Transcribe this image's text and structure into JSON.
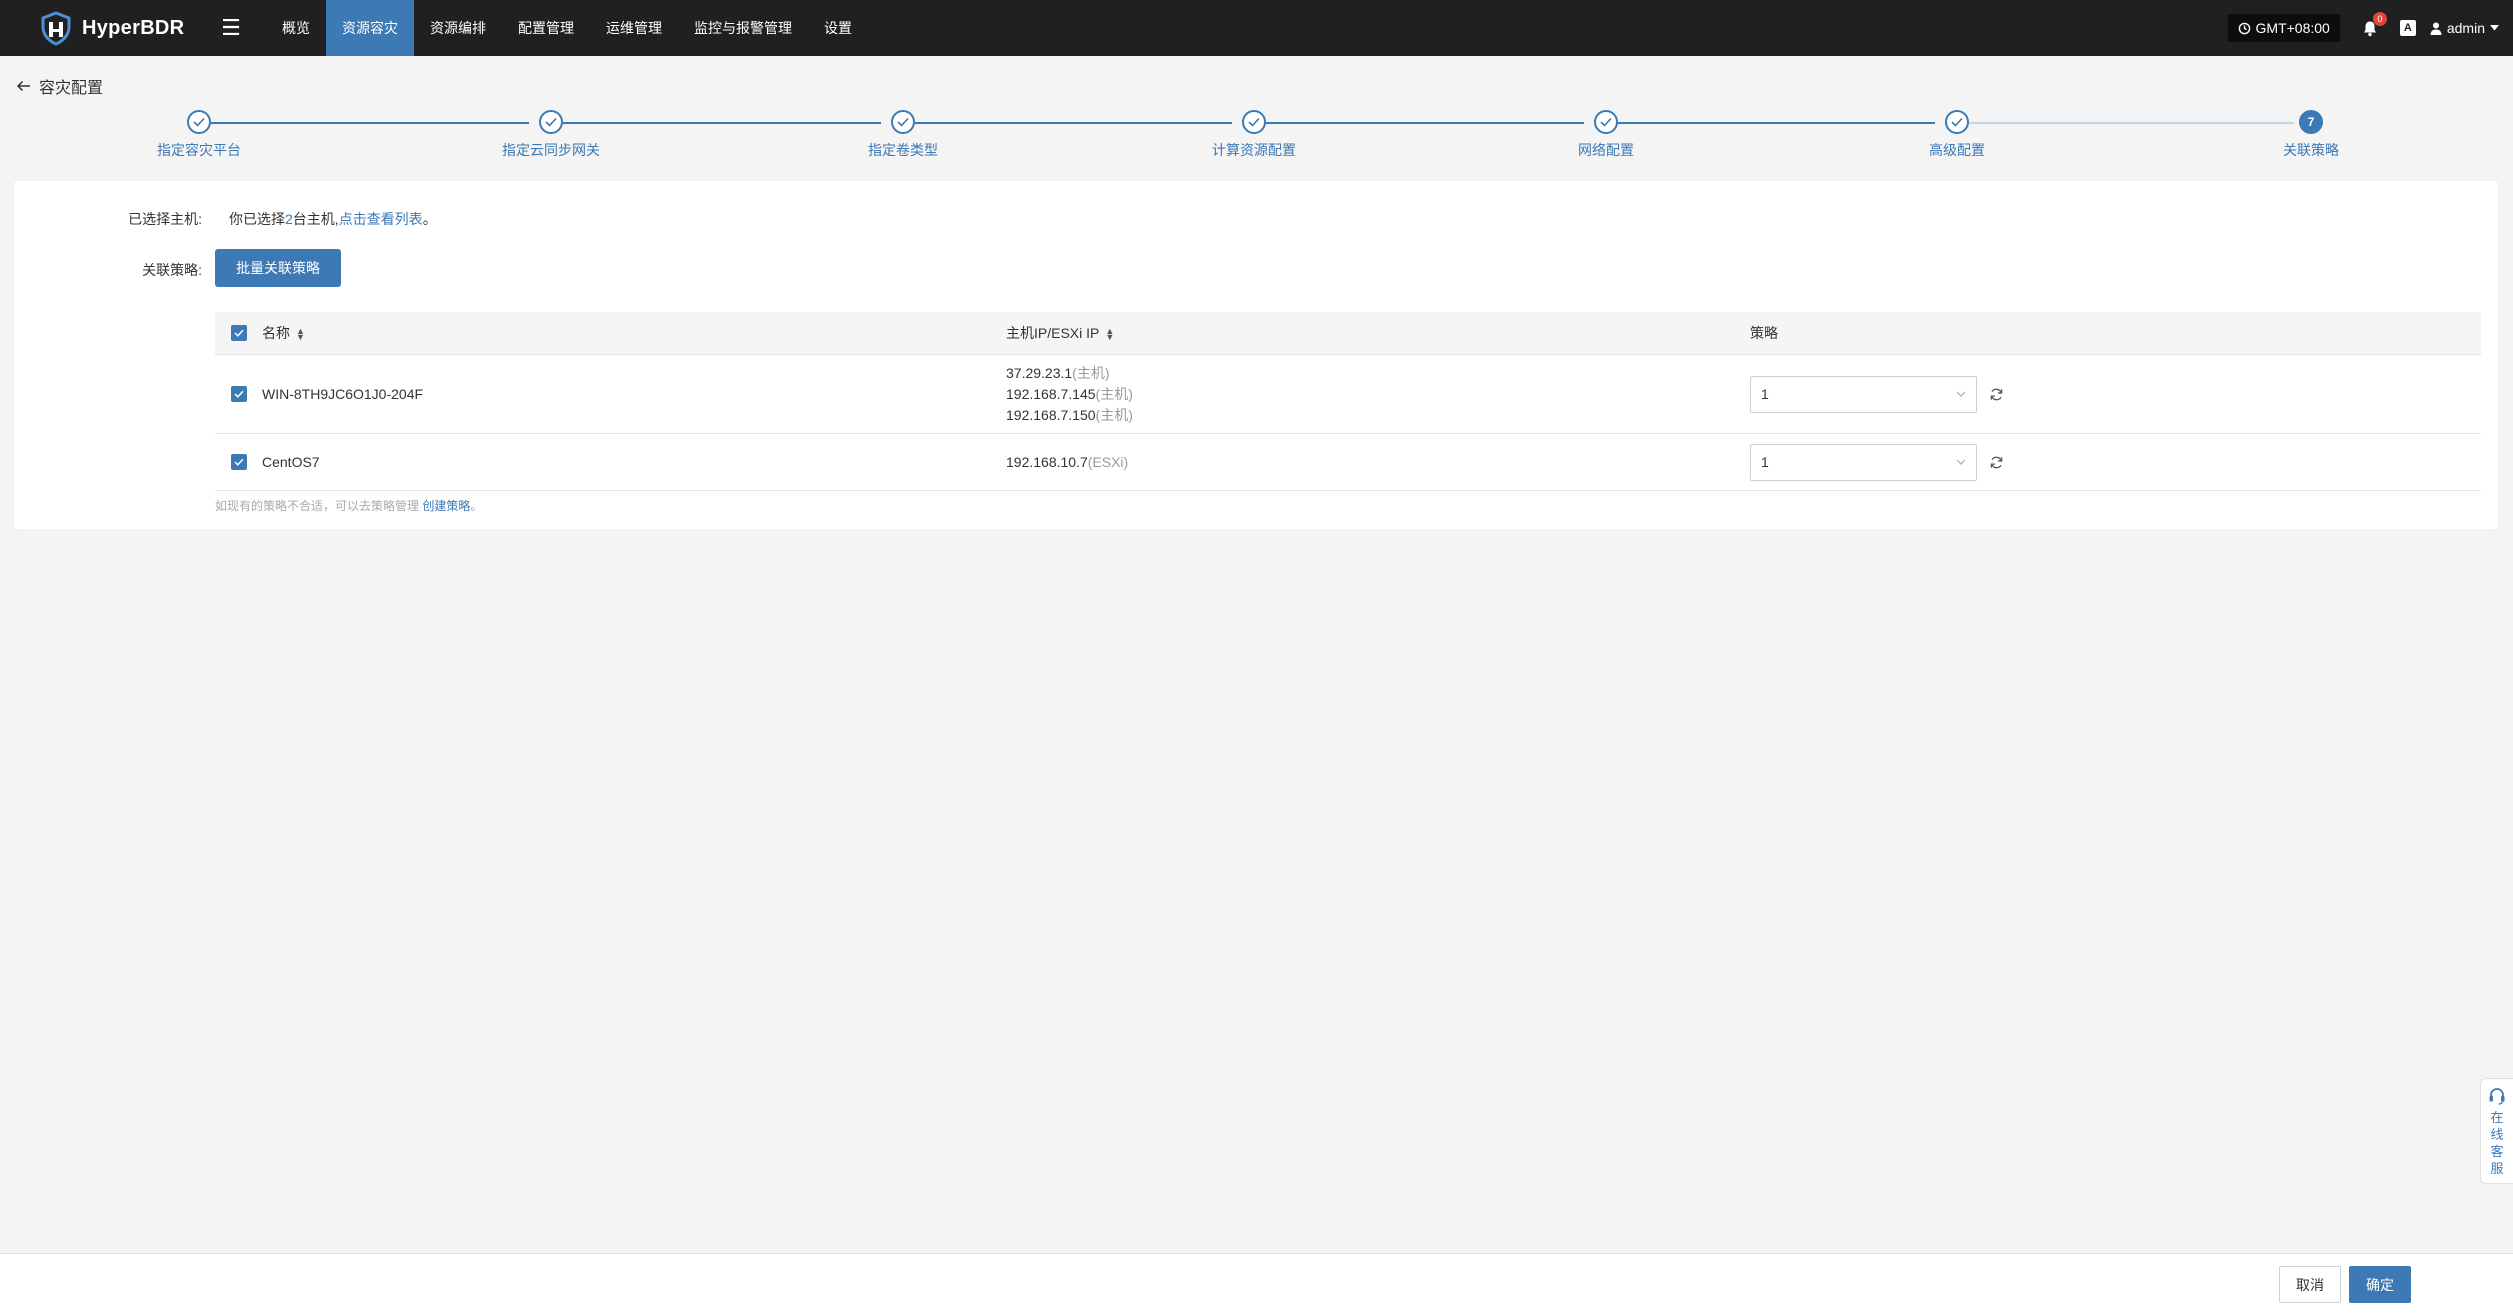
{
  "app": {
    "name": "HyperBDR",
    "colors": {
      "accent": "#3c79b5",
      "topbar": "#202020",
      "page_bg": "#f4f4f4"
    }
  },
  "nav": {
    "items": [
      {
        "label": "概览"
      },
      {
        "label": "资源容灾"
      },
      {
        "label": "资源编排"
      },
      {
        "label": "配置管理"
      },
      {
        "label": "运维管理"
      },
      {
        "label": "监控与报警管理"
      },
      {
        "label": "设置"
      }
    ],
    "active_index": 1
  },
  "topbar": {
    "timezone": "GMT+08:00",
    "notifications_count": "0",
    "font_icon": "A",
    "user": "admin"
  },
  "page": {
    "title": "容灾配置"
  },
  "steps": [
    {
      "label": "指定容灾平台",
      "status": "done"
    },
    {
      "label": "指定云同步网关",
      "status": "done"
    },
    {
      "label": "指定卷类型",
      "status": "done"
    },
    {
      "label": "计算资源配置",
      "status": "done"
    },
    {
      "label": "网络配置",
      "status": "done"
    },
    {
      "label": "高级配置",
      "status": "done"
    },
    {
      "label": "关联策略",
      "status": "current",
      "number": "7"
    }
  ],
  "form": {
    "selected_label": "已选择主机:",
    "selected_prefix": "你已选择",
    "selected_count": "2",
    "selected_suffix": "台主机,",
    "view_list_link": "点击查看列表",
    "period": "。",
    "policy_label": "关联策略:",
    "batch_button": "批量关联策略"
  },
  "table": {
    "headers": {
      "name": "名称",
      "ip": "主机IP/ESXi IP",
      "policy": "策略"
    },
    "rows": [
      {
        "name": "WIN-8TH9JC6O1J0-204F",
        "ips": [
          {
            "ip": "37.29.23.1",
            "type": "(主机)"
          },
          {
            "ip": "192.168.7.145",
            "type": "(主机)"
          },
          {
            "ip": "192.168.7.150",
            "type": "(主机)"
          }
        ],
        "policy": "1",
        "checked": true
      },
      {
        "name": "CentOS7",
        "ips": [
          {
            "ip": "192.168.10.7",
            "type": "(ESXi)"
          }
        ],
        "policy": "1",
        "checked": true
      }
    ],
    "note_prefix": "如现有的策略不合适，可以去策略管理 ",
    "note_link": "创建策略",
    "note_suffix": "。"
  },
  "footer": {
    "cancel": "取消",
    "confirm": "确定"
  },
  "service": {
    "label": "在线客服"
  }
}
